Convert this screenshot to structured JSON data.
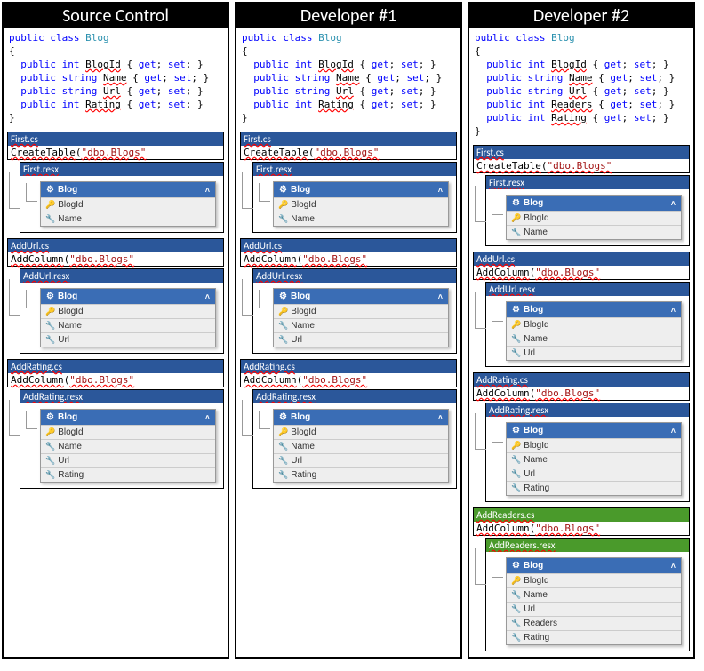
{
  "columns": [
    {
      "title": "Source Control",
      "props": [
        "BlogId",
        "Name",
        "Url",
        "Rating"
      ],
      "migs": [
        {
          "cs": "First.cs",
          "op": "CreateTable",
          "resx": "First.resx",
          "flds": [
            "BlogId",
            "Name"
          ]
        },
        {
          "cs": "AddUrl.cs",
          "op": "AddColumn",
          "resx": "AddUrl.resx",
          "flds": [
            "BlogId",
            "Name",
            "Url"
          ]
        },
        {
          "cs": "AddRating.cs",
          "op": "AddColumn",
          "resx": "AddRating.resx",
          "flds": [
            "BlogId",
            "Name",
            "Url",
            "Rating"
          ]
        }
      ]
    },
    {
      "title": "Developer #1",
      "props": [
        "BlogId",
        "Name",
        "Url",
        "Rating"
      ],
      "migs": [
        {
          "cs": "First.cs",
          "op": "CreateTable",
          "resx": "First.resx",
          "flds": [
            "BlogId",
            "Name"
          ]
        },
        {
          "cs": "AddUrl.cs",
          "op": "AddColumn",
          "resx": "AddUrl.resx",
          "flds": [
            "BlogId",
            "Name",
            "Url"
          ]
        },
        {
          "cs": "AddRating.cs",
          "op": "AddColumn",
          "resx": "AddRating.resx",
          "flds": [
            "BlogId",
            "Name",
            "Url",
            "Rating"
          ]
        }
      ]
    },
    {
      "title": "Developer #2",
      "props": [
        "BlogId",
        "Name",
        "Url",
        "Readers",
        "Rating"
      ],
      "migs": [
        {
          "cs": "First.cs",
          "op": "CreateTable",
          "resx": "First.resx",
          "flds": [
            "BlogId",
            "Name"
          ]
        },
        {
          "cs": "AddUrl.cs",
          "op": "AddColumn",
          "resx": "AddUrl.resx",
          "flds": [
            "BlogId",
            "Name",
            "Url"
          ]
        },
        {
          "cs": "AddRating.cs",
          "op": "AddColumn",
          "resx": "AddRating.resx",
          "flds": [
            "BlogId",
            "Name",
            "Url",
            "Rating"
          ]
        },
        {
          "cs": "AddReaders.cs",
          "op": "AddColumn",
          "resx": "AddReaders.resx",
          "flds": [
            "BlogId",
            "Name",
            "Url",
            "Readers",
            "Rating"
          ],
          "green": true
        }
      ]
    }
  ],
  "cls": "Blog",
  "tbl": "dbo.Blogs",
  "kw": {
    "public": "public",
    "class": "class",
    "get": "get",
    "set": "set"
  },
  "types": {
    "BlogId": "int",
    "Name": "string",
    "Url": "string",
    "Rating": "int",
    "Readers": "int"
  }
}
